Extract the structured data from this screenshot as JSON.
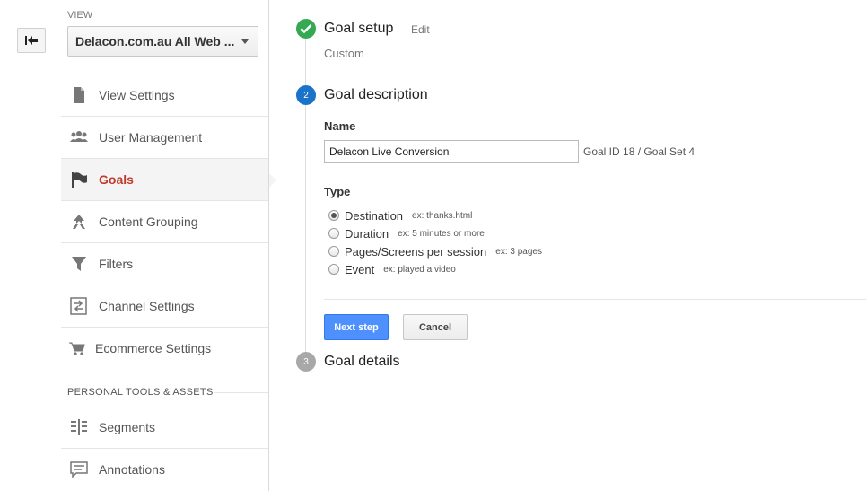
{
  "sidebar": {
    "view_label": "VIEW",
    "view_select": "Delacon.com.au All Web ...",
    "items": [
      {
        "label": "View Settings",
        "icon": "document-icon"
      },
      {
        "label": "User Management",
        "icon": "users-icon"
      },
      {
        "label": "Goals",
        "icon": "flag-icon",
        "active": true
      },
      {
        "label": "Content Grouping",
        "icon": "content-grouping-icon"
      },
      {
        "label": "Filters",
        "icon": "filter-icon"
      },
      {
        "label": "Channel Settings",
        "icon": "channel-settings-icon"
      },
      {
        "label": "Ecommerce Settings",
        "icon": "cart-icon"
      }
    ],
    "section_header": "PERSONAL TOOLS & ASSETS",
    "tools": [
      {
        "label": "Segments",
        "icon": "segments-icon"
      },
      {
        "label": "Annotations",
        "icon": "annotations-icon"
      }
    ]
  },
  "steps": {
    "setup": {
      "title": "Goal setup",
      "edit_label": "Edit",
      "subtitle": "Custom"
    },
    "description": {
      "number": "2",
      "title": "Goal description",
      "name_label": "Name",
      "name_value": "Delacon Live Conversion",
      "goal_id": "Goal ID 18 / Goal Set 4",
      "type_label": "Type",
      "types": [
        {
          "label": "Destination",
          "example": "ex: thanks.html",
          "checked": true
        },
        {
          "label": "Duration",
          "example": "ex: 5 minutes or more",
          "checked": false
        },
        {
          "label": "Pages/Screens per session",
          "example": "ex: 3 pages",
          "checked": false
        },
        {
          "label": "Event",
          "example": "ex: played a video",
          "checked": false
        }
      ],
      "next_label": "Next step",
      "cancel_label": "Cancel"
    },
    "details": {
      "number": "3",
      "title": "Goal details"
    }
  },
  "colors": {
    "step_complete": "#34a853",
    "step_active": "#1a73c8",
    "step_pending": "#a8a8a8",
    "active_nav": "#c0392b",
    "primary_button": "#4d90fe"
  }
}
